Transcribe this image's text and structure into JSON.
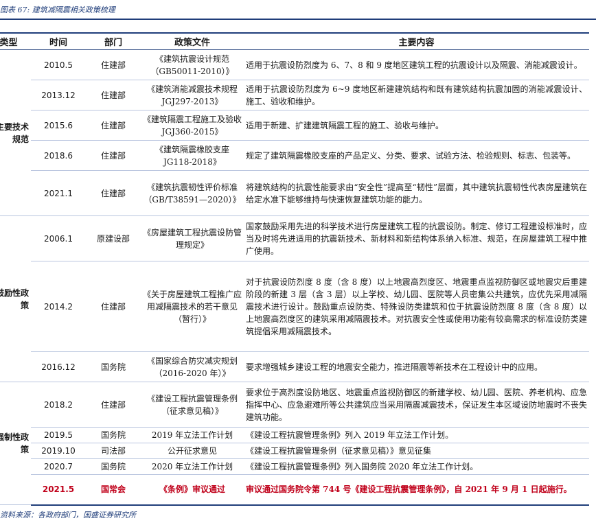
{
  "caption": "图表 67:  建筑减隔震相关政策梳理",
  "headers": [
    "类型",
    "时间",
    "部门",
    "政策文件",
    "主要内容"
  ],
  "categories": [
    "主要技术规范",
    "鼓励性政策",
    "强制性政策"
  ],
  "rows": [
    {
      "time": "2010.5",
      "dept": "住建部",
      "file": "《建筑抗震设计规范（GB50011-2010）》",
      "content": "适用于抗震设防烈度为 6、7、8 和 9 度地区建筑工程的抗震设计以及隔震、消能减震设计。"
    },
    {
      "time": "2013.12",
      "dept": "住建部",
      "file": "《建筑消能减震技术规程 JGJ297-2013》",
      "content": "适用于抗震设防烈度为 6~9 度地区新建建筑结构和既有建筑结构抗震加固的消能减震设计、施工、验收和维护。"
    },
    {
      "time": "2015.6",
      "dept": "住建部",
      "file": "《建筑隔震工程施工及验收 JGJ360-2015》",
      "content": "适用于新建、扩建建筑隔震工程的施工、验收与维护。"
    },
    {
      "time": "2018.6",
      "dept": "住建部",
      "file": "《建筑隔震橡胶支座 JG118-2018》",
      "content": "规定了建筑隔震橡胶支座的产品定义、分类、要求、试验方法、检验规则、标志、包装等。"
    },
    {
      "time": "2021.1",
      "dept": "住建部",
      "file": "《建筑抗震韧性评价标准（GB/T38591—2020）》",
      "content": "将建筑结构的抗震性能要求由“安全性”提高至“韧性”层面，其中建筑抗震韧性代表房屋建筑在给定水准下能够维持与快速恢复建筑功能的能力。"
    },
    {
      "time": "2006.1",
      "dept": "原建设部",
      "file": "《房屋建筑工程抗震设防管理规定》",
      "content": "国家鼓励采用先进的科学技术进行房屋建筑工程的抗震设防。制定、修订工程建设标准时，应当及时将先进适用的抗震新技术、新材料和新结构体系纳入标准、规范，在房屋建筑工程中推广使用。"
    },
    {
      "time": "2014.2",
      "dept": "住建部",
      "file": "《关于房屋建筑工程推广应用减隔震技术的若干意见（暂行）》",
      "content": "对于抗震设防烈度 8 度（含 8 度）以上地震高烈度区、地震重点监视防御区或地震灾后重建阶段的新建 3 层（含 3 层）以上学校、幼儿园、医院等人员密集公共建筑，应优先采用减隔震技术进行设计。鼓励重点设防类、特殊设防类建筑和位于抗震设防烈度 8 度（含 8 度）以上地震高烈度区的建筑采用减隔震技术。对抗震安全性或使用功能有较高需求的标准设防类建筑提倡采用减隔震技术。"
    },
    {
      "time": "2016.12",
      "dept": "国务院",
      "file": "《国家综合防灾减灾规划（2016-2020 年）》",
      "content": "要求增强城乡建设工程的地震安全能力，推进隔震等新技术在工程设计中的应用。"
    },
    {
      "time": "2018.2",
      "dept": "住建部",
      "file": "《建设工程抗震管理条例（征求意见稿）》",
      "content": "要求位于高烈度设防地区、地震重点监视防御区的新建学校、幼儿园、医院、养老机构、应急指挥中心、应急避难所等公共建筑应当采用隔震减震技术，保证发生本区域设防地震时不丧失建筑功能。"
    },
    {
      "time": "2019.5",
      "dept": "国务院",
      "file": "2019 年立法工作计划",
      "content": "《建设工程抗震管理条例》列入 2019 年立法工作计划。"
    },
    {
      "time": "2019.10",
      "dept": "司法部",
      "file": "公开征求意见",
      "content": "《建设工程抗震管理条例（征求意见稿）》意见征集"
    },
    {
      "time": "2020.7",
      "dept": "国务院",
      "file": "2020 年立法工作计划",
      "content": "《建设工程抗震管理条例》列入国务院 2020 年立法工作计划。"
    },
    {
      "time": "2021.5",
      "dept": "国常会",
      "file": "《条例》审议通过",
      "content": "审议通过国务院令第 744 号《建设工程抗震管理条例》，自 2021 年 9 月 1 日起施行。"
    }
  ],
  "source": "资料来源：各政府部门，国盛证券研究所",
  "colors": {
    "accent": "#1f3d7a",
    "highlight": "#c0001a",
    "rule": "#b8c4de"
  }
}
